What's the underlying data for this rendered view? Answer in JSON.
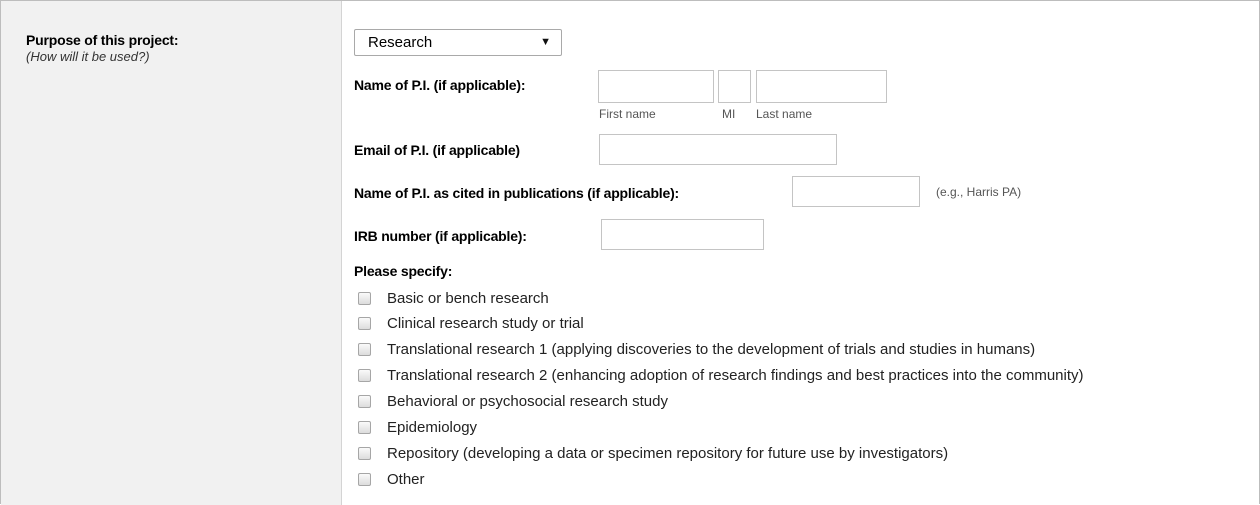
{
  "purpose": {
    "title": "Purpose of this project:",
    "subtitle": "(How will it be used?)",
    "selected": "Research",
    "arrow": "▼"
  },
  "pi_name": {
    "label": "Name of P.I. (if applicable):",
    "first_caption": "First name",
    "mi_caption": "MI",
    "last_caption": "Last name",
    "first_value": "",
    "mi_value": "",
    "last_value": ""
  },
  "pi_email": {
    "label": "Email of P.I. (if applicable)",
    "value": ""
  },
  "pi_cited": {
    "label": "Name of P.I. as cited in publications (if applicable):",
    "value": "",
    "hint": "(e.g., Harris PA)"
  },
  "irb": {
    "label": "IRB number (if applicable):",
    "value": ""
  },
  "specify": {
    "label": "Please specify:",
    "options": [
      "Basic or bench research",
      "Clinical research study or trial",
      "Translational research 1 (applying discoveries to the development of trials and studies in humans)",
      "Translational research 2 (enhancing adoption of research findings and best practices into the community)",
      "Behavioral or psychosocial research study",
      "Epidemiology",
      "Repository (developing a data or specimen repository for future use by investigators)",
      "Other"
    ]
  }
}
